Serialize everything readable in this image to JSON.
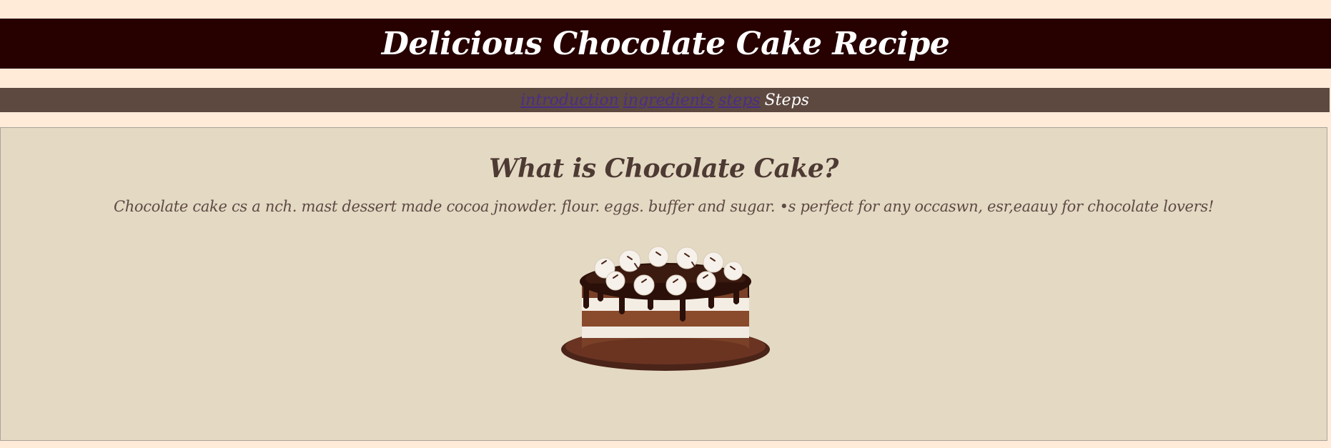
{
  "header": {
    "title": "Delicious Chocolate Cake Recipe"
  },
  "nav": {
    "links": [
      {
        "label": "introduction"
      },
      {
        "label": "ingredients"
      },
      {
        "label": "steps"
      }
    ],
    "current": "Steps"
  },
  "main": {
    "heading": "What is Chocolate Cake?",
    "description": "Chocolate cake cs a nch. mast dessert made cocoa jnowder. flour. eggs. buffer and sugar. •s perfect for any occaswn, esr,eaauy for chocolate lovers!",
    "image_icon": "chocolate-cake-photo"
  },
  "colors": {
    "page_bg": "#ffebd8",
    "header_bg": "#270000",
    "nav_bg": "#5d4940",
    "main_bg": "#e4d9c3",
    "link": "#4a2d8a",
    "heading": "#4d3a33"
  }
}
